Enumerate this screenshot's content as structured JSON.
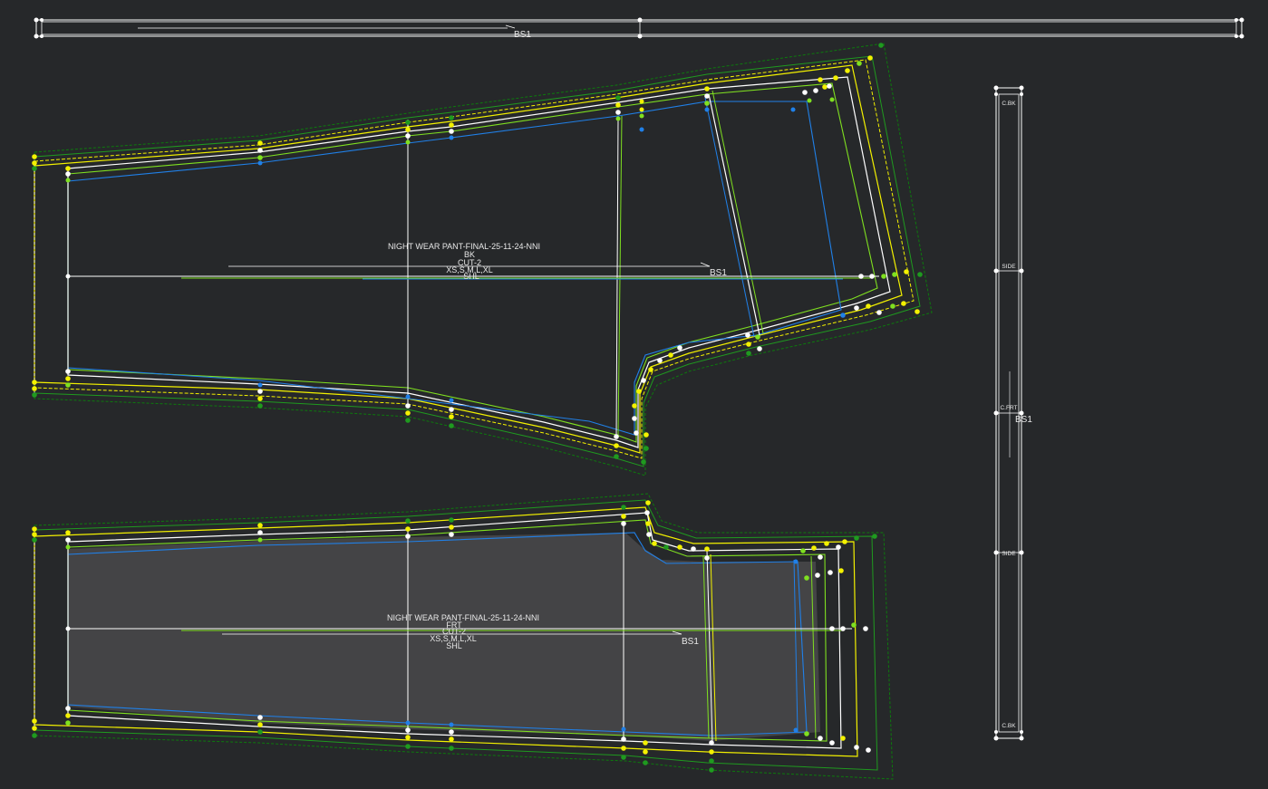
{
  "canvas": {
    "background": "#26282a"
  },
  "colors": {
    "base": "#ffffff",
    "grade_yellow": "#f3f100",
    "grade_lime": "#7fe020",
    "grade_green": "#1f9a1f",
    "grade_dark_green": "#0d7a0d",
    "grade_blue": "#2080e8",
    "fill_piece": "#444446"
  },
  "top_strip": {
    "ref_label": "BS1"
  },
  "back_piece": {
    "name": "NIGHT WEAR PANT-FINAL-25-11-24-NNI",
    "piece": "BK",
    "cut": "CUT-2",
    "sizes": "XS,S,M,L,XL",
    "material": "SHL",
    "ref_label": "BS1"
  },
  "front_piece": {
    "name": "NIGHT WEAR PANT-FINAL-25-11-24-NNI",
    "piece": "FRT",
    "cut": "CUT-2",
    "sizes": "XS,S,M,L,XL",
    "material": "SHL",
    "ref_label": "BS1"
  },
  "waistband": {
    "marks": [
      "C.BK",
      "SIDE",
      "C.FRT",
      "SIDE",
      "C.BK"
    ],
    "ref_label": "BS1"
  }
}
